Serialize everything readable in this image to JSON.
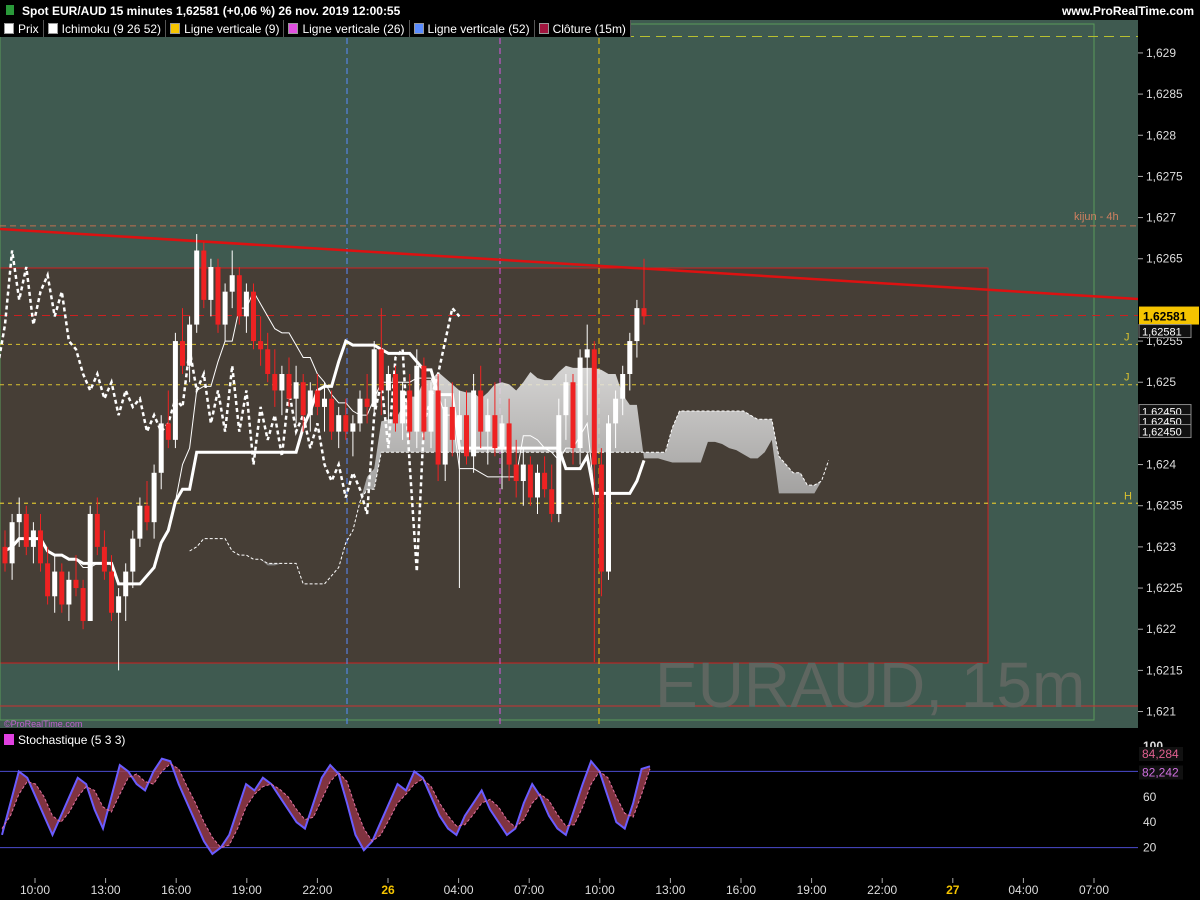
{
  "header": {
    "title": "Spot EUR/AUD 15 minutes 1,62581 (+0,06 %) 26 nov. 2019 12:00:55",
    "site": "www.ProRealTime.com"
  },
  "legend": [
    {
      "label": "Prix",
      "color": "#ffffff"
    },
    {
      "label": "Ichimoku (9 26 52)",
      "color": "#ffffff"
    },
    {
      "label": "Ligne verticale (9)",
      "color": "#f5c400"
    },
    {
      "label": "Ligne verticale (26)",
      "color": "#e050e0"
    },
    {
      "label": "Ligne verticale (52)",
      "color": "#5a8cff"
    },
    {
      "label": "Clôture (15m)",
      "color": "#a0153e"
    }
  ],
  "watermark": "EURAUD, 15m",
  "credit": "©ProRealTime.com",
  "stoch_label": "Stochastique (5 3 3)",
  "price_axis": {
    "ticks": [
      "1,629",
      "1,6285",
      "1,628",
      "1,6275",
      "1,627",
      "1,6265",
      "1,6255",
      "1,625",
      "1,624",
      "1,6235",
      "1,623",
      "1,6225",
      "1,622",
      "1,6215",
      "1,621"
    ],
    "tick_values": [
      1.629,
      1.6285,
      1.628,
      1.6275,
      1.627,
      1.6265,
      1.6255,
      1.625,
      1.624,
      1.6235,
      1.623,
      1.6225,
      1.622,
      1.6215,
      1.621
    ],
    "current_price": "1,62581",
    "current_value": 1.62581,
    "kijun_label": "kijun  - 4h",
    "kijun_value": 1.6269,
    "extra_labels": [
      "1,62581",
      "1,62450",
      "1,62450",
      "1,62450"
    ],
    "level_labels": [
      {
        "text": "J",
        "value": 1.62546
      },
      {
        "text": "J",
        "value": 1.62497
      },
      {
        "text": "H",
        "value": 1.62353
      }
    ]
  },
  "stoch_axis": {
    "ticks": [
      "100",
      "80",
      "60",
      "40",
      "20"
    ],
    "values": [
      100,
      80,
      60,
      40,
      20
    ],
    "k_label": "84,284",
    "d_label": "82,242",
    "k_value": 84.284,
    "d_value": 82.242
  },
  "time_axis": [
    "10:00",
    "13:00",
    "16:00",
    "19:00",
    "22:00",
    "26",
    "04:00",
    "07:00",
    "10:00",
    "13:00",
    "16:00",
    "19:00",
    "22:00",
    "27",
    "04:00",
    "07:00"
  ],
  "colors": {
    "resistance": "#dd1111",
    "cloud": "#c8c8c8",
    "up": "#ffffff",
    "down": "#ee2222",
    "stochK": "#6a5cff",
    "stochD": "#d04060"
  },
  "chart_data": {
    "type": "candlestick",
    "title": "Spot EUR/AUD 15 minutes",
    "ylim": [
      1.6208,
      1.6294
    ],
    "x_start": "2019-11-25 09:00",
    "candles": [
      [
        1.623,
        1.6232,
        1.6227,
        1.6228
      ],
      [
        1.6228,
        1.6234,
        1.6226,
        1.6233
      ],
      [
        1.6233,
        1.6236,
        1.623,
        1.6234
      ],
      [
        1.6234,
        1.6235,
        1.6229,
        1.623
      ],
      [
        1.623,
        1.6233,
        1.6228,
        1.6232
      ],
      [
        1.6232,
        1.6234,
        1.6227,
        1.6228
      ],
      [
        1.6228,
        1.623,
        1.6223,
        1.6224
      ],
      [
        1.6224,
        1.6229,
        1.6222,
        1.6227
      ],
      [
        1.6227,
        1.6228,
        1.6222,
        1.6223
      ],
      [
        1.6223,
        1.6227,
        1.6221,
        1.6226
      ],
      [
        1.6226,
        1.6229,
        1.6224,
        1.6225
      ],
      [
        1.6225,
        1.6226,
        1.622,
        1.6221
      ],
      [
        1.6221,
        1.6235,
        1.6221,
        1.6234
      ],
      [
        1.6234,
        1.6236,
        1.6229,
        1.623
      ],
      [
        1.623,
        1.6232,
        1.6226,
        1.6227
      ],
      [
        1.6227,
        1.6229,
        1.6221,
        1.6222
      ],
      [
        1.6222,
        1.6225,
        1.6215,
        1.6224
      ],
      [
        1.6224,
        1.6228,
        1.6221,
        1.6227
      ],
      [
        1.6227,
        1.6232,
        1.6225,
        1.6231
      ],
      [
        1.6231,
        1.6236,
        1.623,
        1.6235
      ],
      [
        1.6235,
        1.6238,
        1.6232,
        1.6233
      ],
      [
        1.6233,
        1.624,
        1.6231,
        1.6239
      ],
      [
        1.6239,
        1.6246,
        1.6237,
        1.6245
      ],
      [
        1.6245,
        1.6249,
        1.6242,
        1.6243
      ],
      [
        1.6243,
        1.6256,
        1.6242,
        1.6255
      ],
      [
        1.6255,
        1.6259,
        1.6251,
        1.6252
      ],
      [
        1.6252,
        1.6258,
        1.625,
        1.6257
      ],
      [
        1.6257,
        1.6268,
        1.6256,
        1.6266
      ],
      [
        1.6266,
        1.6267,
        1.6259,
        1.626
      ],
      [
        1.626,
        1.6265,
        1.6258,
        1.6264
      ],
      [
        1.6264,
        1.6265,
        1.6256,
        1.6257
      ],
      [
        1.6257,
        1.6262,
        1.6255,
        1.6261
      ],
      [
        1.6261,
        1.6266,
        1.6259,
        1.6263
      ],
      [
        1.6263,
        1.6264,
        1.6257,
        1.6258
      ],
      [
        1.6258,
        1.6262,
        1.6256,
        1.6261
      ],
      [
        1.6261,
        1.6262,
        1.6254,
        1.6255
      ],
      [
        1.6255,
        1.6258,
        1.6252,
        1.6254
      ],
      [
        1.6254,
        1.6256,
        1.625,
        1.6251
      ],
      [
        1.6251,
        1.6254,
        1.6247,
        1.6249
      ],
      [
        1.6249,
        1.6252,
        1.6246,
        1.6251
      ],
      [
        1.6251,
        1.6253,
        1.6247,
        1.6248
      ],
      [
        1.6248,
        1.6252,
        1.6245,
        1.625
      ],
      [
        1.625,
        1.6251,
        1.6244,
        1.6246
      ],
      [
        1.6246,
        1.625,
        1.6244,
        1.6249
      ],
      [
        1.6249,
        1.6251,
        1.6246,
        1.6247
      ],
      [
        1.6247,
        1.625,
        1.6244,
        1.6248
      ],
      [
        1.6248,
        1.6249,
        1.6243,
        1.6244
      ],
      [
        1.6244,
        1.6247,
        1.6242,
        1.6246
      ],
      [
        1.6246,
        1.6248,
        1.6243,
        1.6244
      ],
      [
        1.6244,
        1.6246,
        1.6241,
        1.6245
      ],
      [
        1.6245,
        1.6249,
        1.6244,
        1.6248
      ],
      [
        1.6248,
        1.6251,
        1.6245,
        1.6247
      ],
      [
        1.6247,
        1.6255,
        1.6246,
        1.6254
      ],
      [
        1.6254,
        1.6259,
        1.6246,
        1.6249
      ],
      [
        1.6249,
        1.6252,
        1.6245,
        1.6251
      ],
      [
        1.6251,
        1.6252,
        1.6244,
        1.6245
      ],
      [
        1.6245,
        1.625,
        1.6243,
        1.6249
      ],
      [
        1.6249,
        1.6251,
        1.6243,
        1.6244
      ],
      [
        1.6244,
        1.6254,
        1.6242,
        1.6252
      ],
      [
        1.6252,
        1.6253,
        1.6243,
        1.6244
      ],
      [
        1.6244,
        1.625,
        1.6242,
        1.6249
      ],
      [
        1.6249,
        1.6251,
        1.6238,
        1.624
      ],
      [
        1.624,
        1.6248,
        1.6238,
        1.6247
      ],
      [
        1.6247,
        1.625,
        1.6241,
        1.6243
      ],
      [
        1.6243,
        1.6249,
        1.6225,
        1.6246
      ],
      [
        1.6246,
        1.6249,
        1.624,
        1.6241
      ],
      [
        1.6241,
        1.6251,
        1.6239,
        1.6249
      ],
      [
        1.6249,
        1.6252,
        1.6242,
        1.6244
      ],
      [
        1.6244,
        1.6248,
        1.624,
        1.6246
      ],
      [
        1.6246,
        1.625,
        1.6241,
        1.6242
      ],
      [
        1.6242,
        1.6246,
        1.6237,
        1.6245
      ],
      [
        1.6245,
        1.6248,
        1.6238,
        1.624
      ],
      [
        1.624,
        1.6243,
        1.6236,
        1.6238
      ],
      [
        1.6238,
        1.6242,
        1.6235,
        1.624
      ],
      [
        1.624,
        1.6241,
        1.6235,
        1.6236
      ],
      [
        1.6236,
        1.624,
        1.6234,
        1.6239
      ],
      [
        1.6239,
        1.6241,
        1.6236,
        1.6237
      ],
      [
        1.6237,
        1.624,
        1.6233,
        1.6234
      ],
      [
        1.6234,
        1.6248,
        1.6233,
        1.6246
      ],
      [
        1.6246,
        1.6251,
        1.6243,
        1.625
      ],
      [
        1.625,
        1.6251,
        1.624,
        1.6242
      ],
      [
        1.6242,
        1.6254,
        1.624,
        1.6253
      ],
      [
        1.6253,
        1.6257,
        1.6246,
        1.6254
      ],
      [
        1.6254,
        1.6255,
        1.6216,
        1.624
      ],
      [
        1.624,
        1.6242,
        1.6224,
        1.6227
      ],
      [
        1.6227,
        1.6246,
        1.6226,
        1.6245
      ],
      [
        1.6245,
        1.6249,
        1.6242,
        1.6248
      ],
      [
        1.6248,
        1.6252,
        1.6246,
        1.6251
      ],
      [
        1.6251,
        1.6256,
        1.6249,
        1.6255
      ],
      [
        1.6255,
        1.626,
        1.6253,
        1.6259
      ],
      [
        1.6259,
        1.6265,
        1.6257,
        1.6258
      ]
    ],
    "support_level": 1.62353,
    "stoch_k": [
      30,
      55,
      80,
      75,
      60,
      45,
      30,
      45,
      60,
      75,
      70,
      50,
      35,
      60,
      85,
      80,
      70,
      65,
      80,
      90,
      88,
      70,
      55,
      40,
      25,
      15,
      20,
      30,
      50,
      70,
      65,
      75,
      70,
      60,
      50,
      40,
      35,
      55,
      75,
      85,
      78,
      55,
      30,
      18,
      25,
      40,
      55,
      70,
      65,
      80,
      75,
      60,
      45,
      35,
      30,
      45,
      55,
      65,
      50,
      40,
      30,
      35,
      55,
      70,
      60,
      45,
      35,
      30,
      50,
      70,
      88,
      80,
      60,
      40,
      35,
      55,
      82,
      84
    ],
    "stoch_d": [
      35,
      45,
      62,
      72,
      70,
      60,
      45,
      40,
      48,
      60,
      68,
      65,
      52,
      48,
      62,
      75,
      78,
      72,
      70,
      80,
      86,
      82,
      68,
      55,
      40,
      28,
      20,
      22,
      35,
      52,
      62,
      68,
      70,
      66,
      60,
      50,
      42,
      44,
      58,
      72,
      79,
      72,
      52,
      35,
      25,
      30,
      42,
      55,
      62,
      70,
      74,
      68,
      55,
      45,
      37,
      38,
      46,
      55,
      58,
      52,
      42,
      36,
      42,
      55,
      62,
      57,
      46,
      37,
      38,
      52,
      70,
      80,
      75,
      60,
      47,
      44,
      62,
      82
    ]
  }
}
